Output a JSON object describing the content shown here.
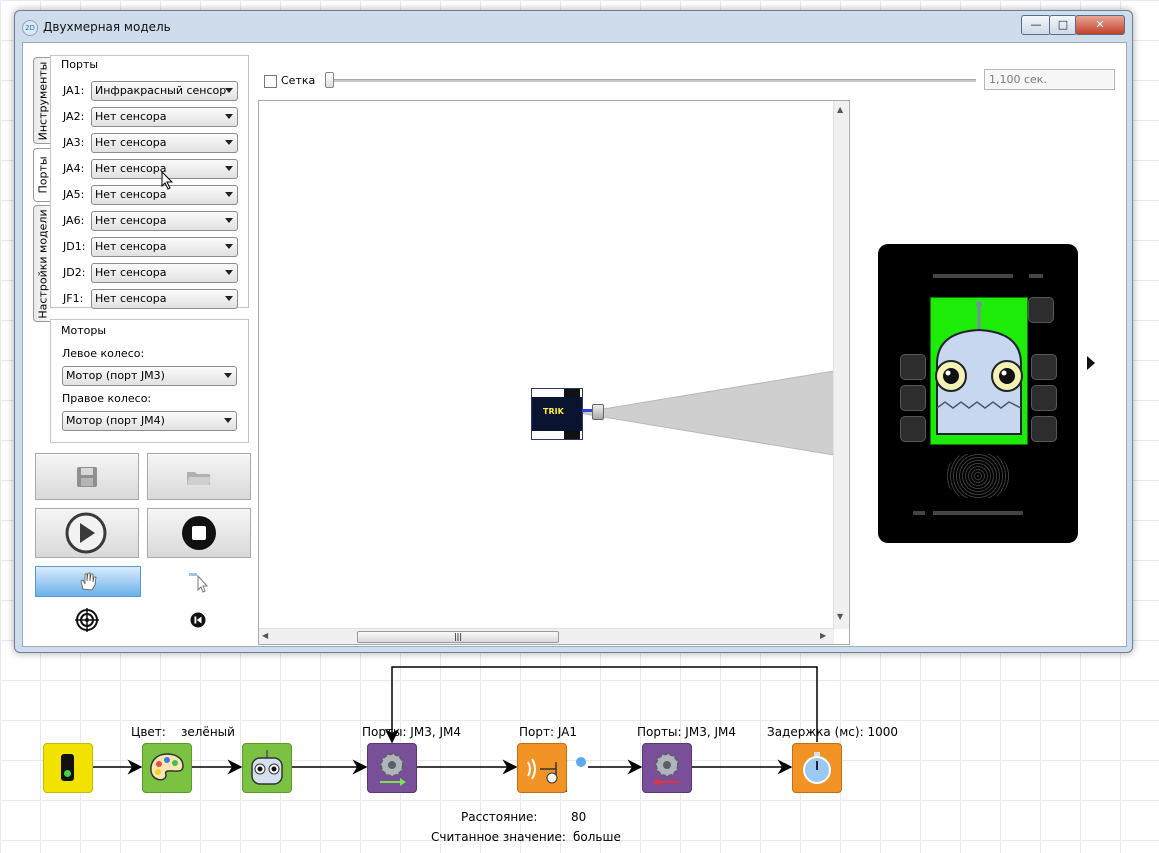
{
  "window": {
    "title": "Двухмерная модель",
    "app_icon": "2D",
    "controls": {
      "minimize": "—",
      "maximize": "□",
      "close": "✕"
    }
  },
  "side_tabs": {
    "tools": "Инструменты",
    "ports": "Порты",
    "model_settings": "Настройки модели"
  },
  "ports": {
    "title": "Порты",
    "rows": [
      {
        "label": "JA1:",
        "value": "Инфракрасный сенсор"
      },
      {
        "label": "JA2:",
        "value": "Нет сенсора"
      },
      {
        "label": "JA3:",
        "value": "Нет сенсора"
      },
      {
        "label": "JA4:",
        "value": "Нет сенсора"
      },
      {
        "label": "JA5:",
        "value": "Нет сенсора"
      },
      {
        "label": "JA6:",
        "value": "Нет сенсора"
      },
      {
        "label": "JD1:",
        "value": "Нет сенсора"
      },
      {
        "label": "JD2:",
        "value": "Нет сенсора"
      },
      {
        "label": "JF1:",
        "value": "Нет сенсора"
      }
    ]
  },
  "motors": {
    "title": "Моторы",
    "left_label": "Левое колесо:",
    "left_value": "Мотор (порт JM3)",
    "right_label": "Правое колесо:",
    "right_value": "Мотор (порт JM4)"
  },
  "toolbar": {
    "grid_label": "Сетка",
    "grid_checked": false,
    "time": "1,100 сек."
  },
  "robot_label": "TRIK",
  "diagram": {
    "color_param": "Цвет:",
    "color_value": "зелёный",
    "ports_param_1": "Порты: JM3, JM4",
    "port_param": "Порт: JA1",
    "ports_param_2": "Порты: JM3, JM4",
    "delay_param": "Задержка (мс): 1000",
    "distance_label": "Расстояние:",
    "distance_value": "80",
    "read_value_label": "Считанное значение:",
    "read_value_value": "больше"
  },
  "colors": {
    "accent_blue": "#3a8fd6",
    "trik_screen": "#1dec09",
    "block_yellow": "#f2e200",
    "block_green": "#7cc242",
    "block_purple": "#7a4f9a",
    "block_orange": "#f29326"
  }
}
